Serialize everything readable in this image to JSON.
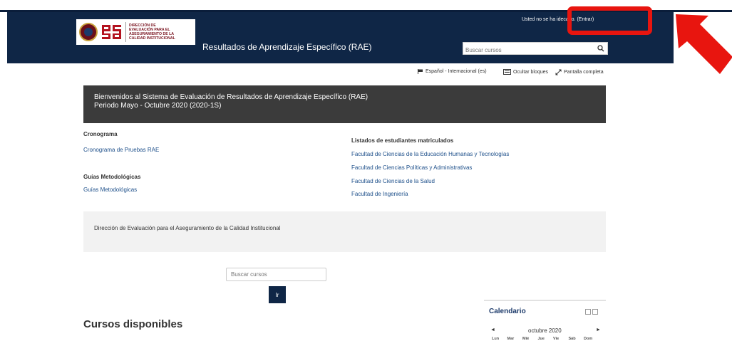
{
  "header": {
    "login_prefix": "Usted no se ha ide",
    "login_mid": "cado. ",
    "login_link": "(Entrar)",
    "logo_text": [
      "DIRECCIÓN DE",
      "EVALUACIÓN PARA EL",
      "ASEGURAMIENTO DE LA",
      "CALIDAD INSTITUCIONAL"
    ],
    "site_name": "Resultados de Aprendizaje Específico (RAE)",
    "search_placeholder": "Buscar cursos"
  },
  "secondary_nav": {
    "language": "Español - Internacional (es)",
    "hide_blocks": "Ocultar bloques",
    "fullscreen": "Pantalla completa"
  },
  "welcome": {
    "line1": "Bienvenidos al Sistema de Evaluación de Resultados de Aprendizaje Específico (RAE)",
    "line2": "Periodo Mayo - Octubre 2020 (2020-1S)"
  },
  "left_col": {
    "schedule_heading": "Cronograma",
    "schedule_link": "Cronograma de Pruebas RAE",
    "guides_heading": "Guías Metodológicas",
    "guides_link": "Guías Metodológicas"
  },
  "right_col": {
    "heading": "Listados de estudiantes matriculados",
    "links": [
      "Facultad de Ciencias de la Educación Humanas y Tecnologías",
      "Facultad de Ciencias Políticas y Administrativas",
      "Facultad de Ciencias de la Salud",
      "Facultad de Ingeniería"
    ]
  },
  "info_box": {
    "text": "Dirección de Evaluación para el Aseguramiento de la Calidad Institucional"
  },
  "main_search": {
    "placeholder": "Buscar cursos",
    "button": "Ir"
  },
  "courses": {
    "title": "Cursos disponibles"
  },
  "calendar": {
    "title": "Calendario",
    "prev": "◄",
    "next": "►",
    "month": "octubre 2020",
    "days": [
      "Lun",
      "Mar",
      "Mié",
      "Jue",
      "Vie",
      "Sáb",
      "Dom"
    ]
  },
  "colors": {
    "navbar": "#0f2646",
    "welcome_bg": "#3b3b3b",
    "link": "#1d4f8a",
    "annotation": "#e8150f"
  }
}
